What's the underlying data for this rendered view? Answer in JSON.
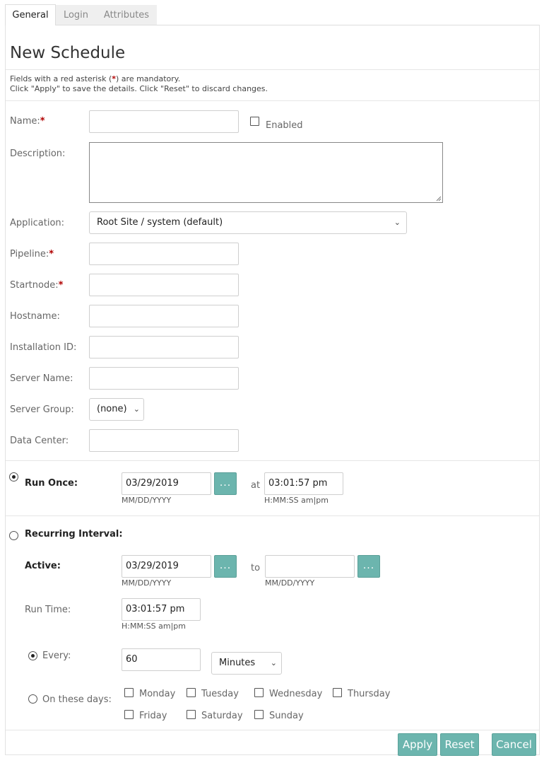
{
  "tabs": {
    "general": "General",
    "login": "Login",
    "attributes": "Attributes"
  },
  "page": {
    "title": "New Schedule",
    "help_line1_pre": "Fields with a red asterisk (",
    "help_asterisk": "*",
    "help_line1_post": ") are mandatory.",
    "help_line2": "Click \"Apply\" to save the details. Click \"Reset\" to discard changes."
  },
  "form": {
    "asterisk": "*",
    "name_label": "Name:",
    "name_value": "",
    "enabled_label": "Enabled",
    "description_label": "Description:",
    "description_value": "",
    "application_label": "Application:",
    "application_value": "Root Site / system (default)",
    "pipeline_label": "Pipeline:",
    "pipeline_value": "",
    "startnode_label": "Startnode:",
    "startnode_value": "",
    "hostname_label": "Hostname:",
    "hostname_value": "",
    "installation_label": "Installation ID:",
    "installation_value": "",
    "server_name_label": "Server Name:",
    "server_name_value": "",
    "server_group_label": "Server Group:",
    "server_group_value": "(none)",
    "data_center_label": "Data Center:",
    "data_center_value": ""
  },
  "run_once": {
    "label": "Run Once:",
    "date": "03/29/2019",
    "date_hint": "MM/DD/YYYY",
    "at_label": "at",
    "time": "03:01:57 pm",
    "time_hint": "H:MM:SS am|pm",
    "selected": true
  },
  "recurring": {
    "label": "Recurring Interval:",
    "active_label": "Active:",
    "from_date": "03/29/2019",
    "from_hint": "MM/DD/YYYY",
    "to_label": "to",
    "to_date": "",
    "to_hint": "MM/DD/YYYY",
    "run_time_label": "Run Time:",
    "run_time": "03:01:57 pm",
    "run_time_hint": "H:MM:SS am|pm",
    "every_label": "Every:",
    "every_value": "60",
    "unit_value": "Minutes",
    "days_label": "On these days:",
    "days": [
      "Monday",
      "Tuesday",
      "Wednesday",
      "Thursday",
      "Friday",
      "Saturday",
      "Sunday"
    ],
    "selected": false
  },
  "buttons": {
    "dots": "...",
    "apply": "Apply",
    "reset": "Reset",
    "cancel": "Cancel"
  },
  "colors": {
    "accent": "#6cb5ae",
    "required": "#b00000"
  }
}
